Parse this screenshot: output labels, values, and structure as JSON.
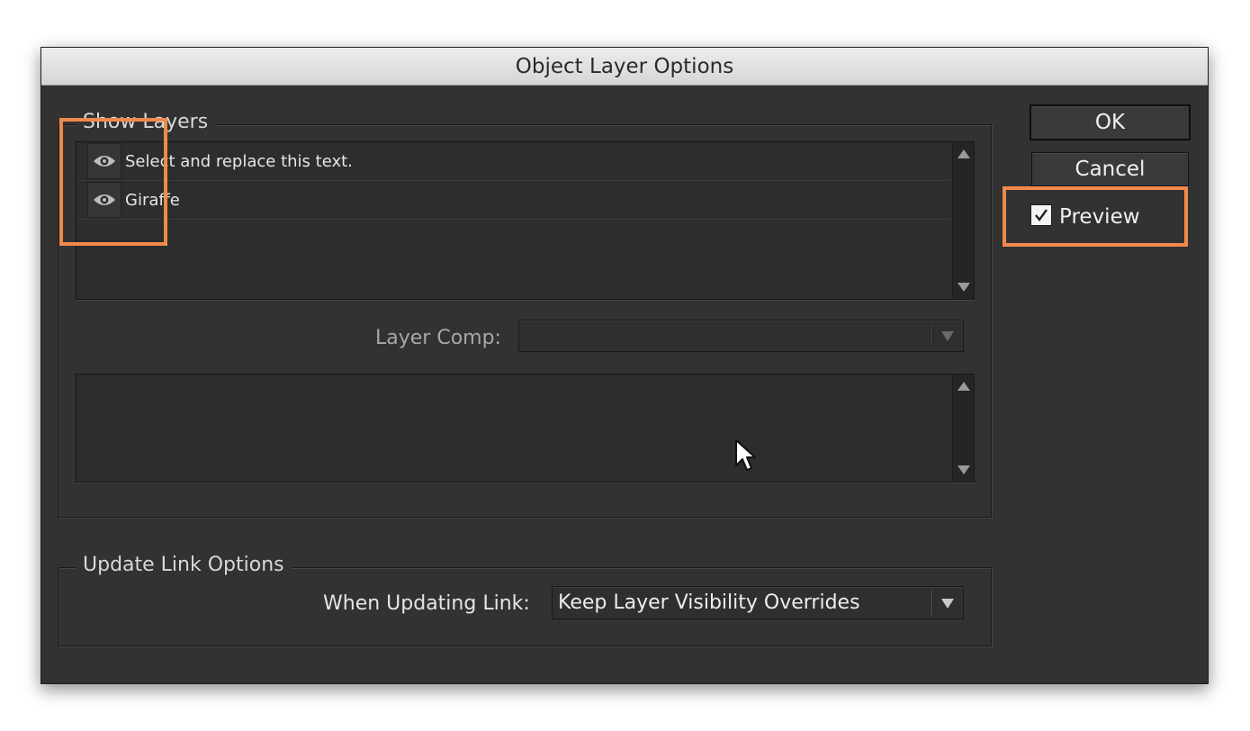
{
  "dialog": {
    "title": "Object Layer Options"
  },
  "show_layers": {
    "legend": "Show Layers",
    "layers": [
      {
        "label": "Select and replace this text.",
        "visible": true,
        "icon": "eye-icon"
      },
      {
        "label": "Giraffe",
        "visible": true,
        "icon": "eye-icon"
      }
    ]
  },
  "layer_comp": {
    "label": "Layer Comp:",
    "value": ""
  },
  "update_link": {
    "legend": "Update Link Options",
    "when_label": "When Updating Link:",
    "value": "Keep Layer Visibility Overrides"
  },
  "buttons": {
    "ok": "OK",
    "cancel": "Cancel"
  },
  "preview": {
    "label": "Preview",
    "checked": true
  },
  "colors": {
    "dialog_bg": "#323232",
    "highlight": "#f08a4b"
  }
}
